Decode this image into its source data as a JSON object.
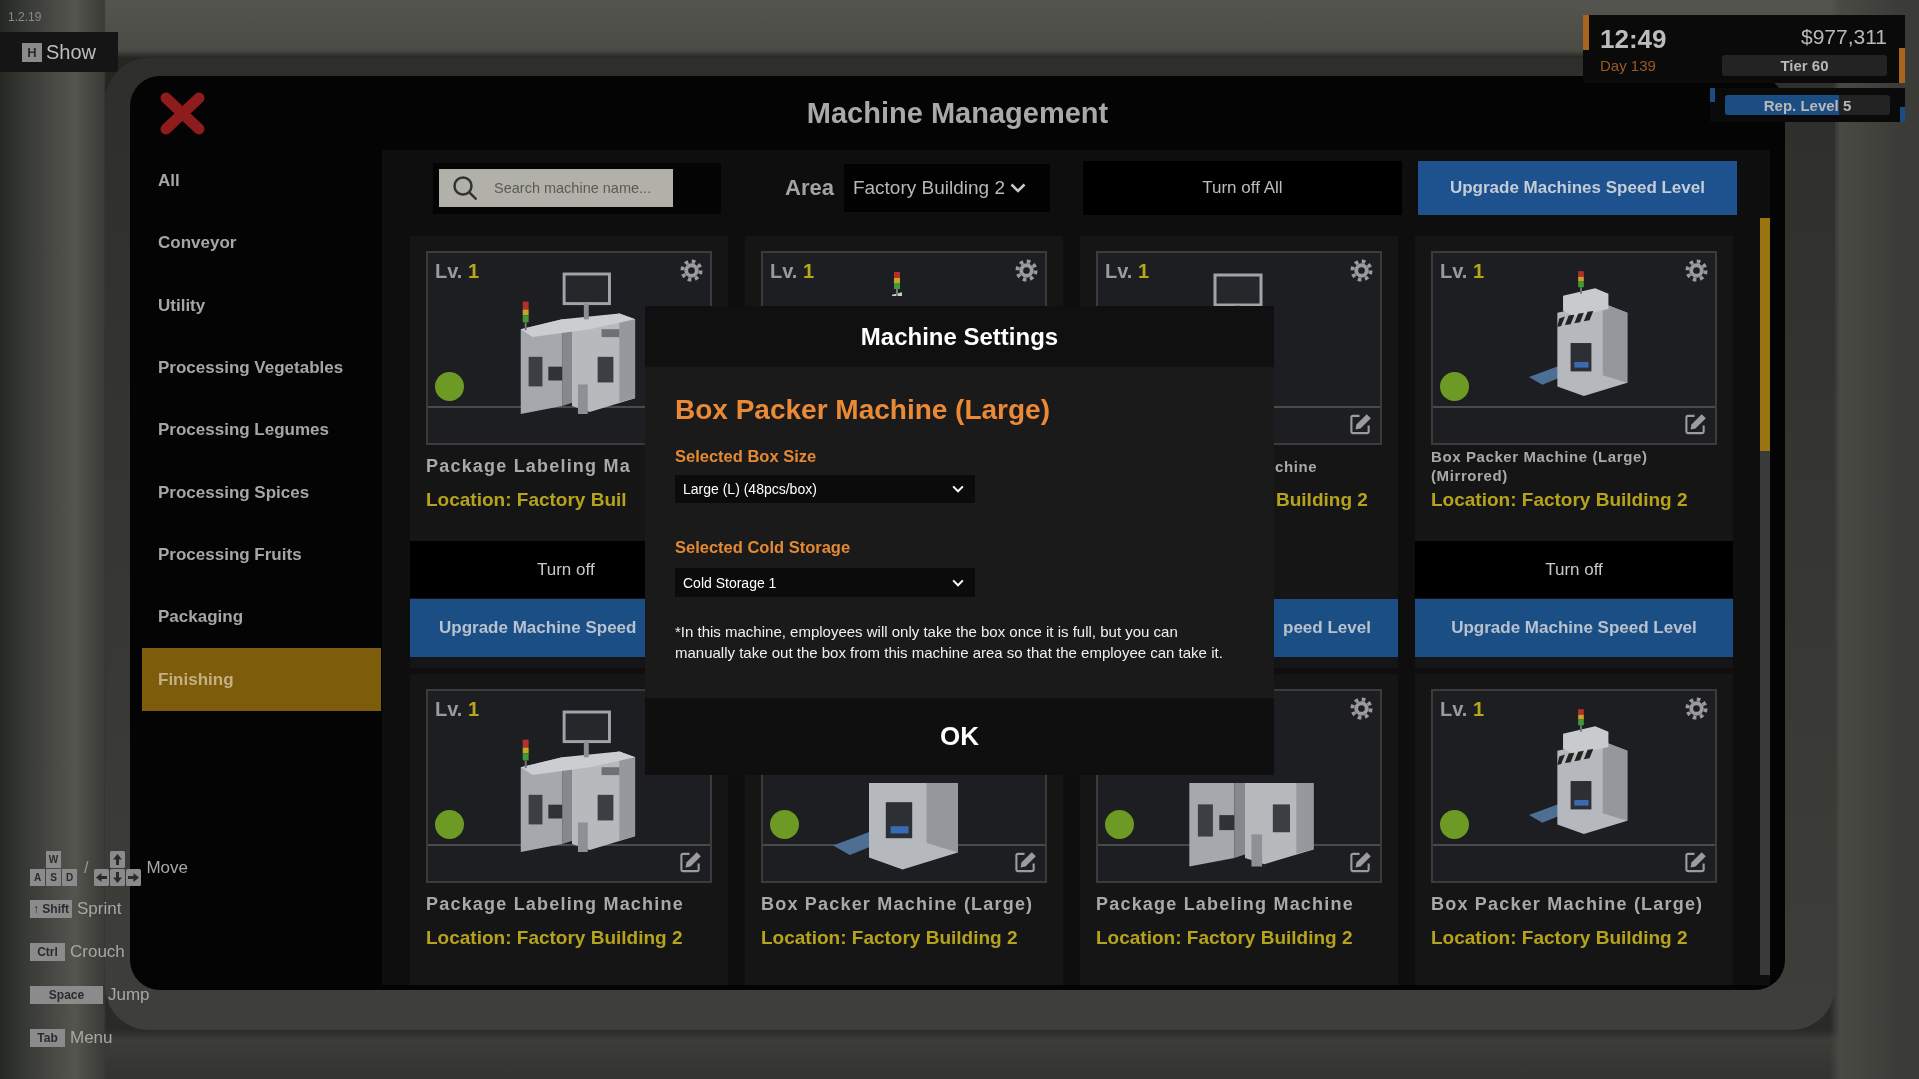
{
  "version": "1.2.19",
  "show_button": {
    "key": "H",
    "label": "Show"
  },
  "hud": {
    "time": "12:49",
    "day": "Day 139",
    "money": "$977,311",
    "tier": "Tier 60",
    "reputation": {
      "label": "Rep. Level 5",
      "level": 0.69
    }
  },
  "window": {
    "title": "Machine Management"
  },
  "sidebar": {
    "items": [
      {
        "label": "All",
        "selected": false
      },
      {
        "label": "Conveyor",
        "selected": false
      },
      {
        "label": "Utility",
        "selected": false
      },
      {
        "label": "Processing Vegetables",
        "selected": false
      },
      {
        "label": "Processing Legumes",
        "selected": false
      },
      {
        "label": "Processing Spices",
        "selected": false
      },
      {
        "label": "Processing Fruits",
        "selected": false
      },
      {
        "label": "Packaging",
        "selected": false
      },
      {
        "label": "Finishing",
        "selected": true
      }
    ]
  },
  "toolbar": {
    "search": {
      "placeholder": "Search machine name..."
    },
    "area": {
      "label": "Area",
      "value": "Factory Building 2"
    },
    "buttons": [
      {
        "kind": "dark",
        "label": "Turn off All"
      },
      {
        "kind": "primary",
        "label": "Upgrade Machines Speed Level"
      }
    ]
  },
  "cards": [
    {
      "kind": "labeler",
      "mirrored": false,
      "lv_prefix": "Lv.",
      "lv_value": "1",
      "on": true,
      "name": "Package Labeling Ma",
      "location": "Location: Factory Buil",
      "turn_off": "Turn off",
      "upgrade": "Upgrade Machine Speed"
    },
    {
      "kind": "packer",
      "lv_prefix": "Lv.",
      "lv_value": "1"
    },
    {
      "kind": "labeler",
      "mirrored": true,
      "lv_prefix": "Lv.",
      "lv_value": "1",
      "name": "chine",
      "location": "Building 2",
      "upgrade": "peed Level"
    },
    {
      "kind": "packer",
      "mirrored": true,
      "lv_prefix": "Lv.",
      "lv_value": "1",
      "on": true,
      "name": "Box Packer Machine (Large) (Mirrored)",
      "location": "Location: Factory Building 2",
      "turn_off": "Turn off",
      "upgrade": "Upgrade Machine Speed Level"
    },
    {
      "kind": "labeler",
      "mirrored": false,
      "lv_prefix": "Lv.",
      "lv_value": "1",
      "on": true,
      "name": "Package Labeling Machine",
      "location": "Location: Factory Building 2"
    },
    {
      "kind": "packer",
      "mirrored": false,
      "on": true,
      "name": "Box Packer Machine (Large)",
      "location": "Location: Factory Building 2"
    },
    {
      "kind": "labeler",
      "mirrored": false,
      "on": true,
      "name": "Package Labeling Machine",
      "location": "Location: Factory Building 2"
    },
    {
      "kind": "packer",
      "mirrored": false,
      "lv_prefix": "Lv.",
      "lv_value": "1",
      "on": true,
      "name": "Box Packer Machine (Large)",
      "location": "Location: Factory Building 2"
    }
  ],
  "dialog": {
    "title": "Machine Settings",
    "machine": "Box Packer Machine (Large)",
    "fields": [
      {
        "label": "Selected Box Size",
        "value": "Large (L) (48pcs/box)"
      },
      {
        "label": "Selected Cold Storage",
        "value": "Cold Storage 1"
      }
    ],
    "note": "*In this machine, employees will only take the box once it is full, but you can\nmanually take out the box from this machine area so that the employee can take it.",
    "ok": "OK"
  },
  "hints": [
    {
      "kind": "move",
      "keys": [
        "W",
        "A",
        "S",
        "D"
      ],
      "separator": "/",
      "action": "Move"
    },
    {
      "kind": "key",
      "keys": [
        "↑ Shift"
      ],
      "action": "Sprint"
    },
    {
      "kind": "key",
      "keys": [
        "Ctrl"
      ],
      "action": "Crouch"
    },
    {
      "kind": "wide",
      "keys": [
        "Space"
      ],
      "action": "Jump"
    },
    {
      "kind": "key",
      "keys": [
        "Tab"
      ],
      "action": "Menu"
    }
  ]
}
